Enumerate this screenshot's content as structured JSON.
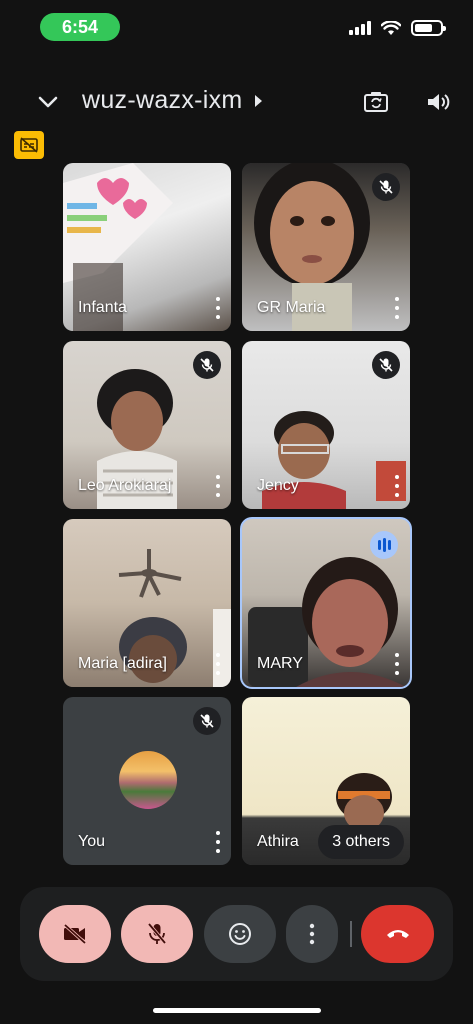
{
  "status_bar": {
    "time": "6:54"
  },
  "header": {
    "meeting_code": "wuz-wazx-ixm"
  },
  "participants": [
    {
      "name": "Infanta",
      "muted": false
    },
    {
      "name": "GR Maria",
      "muted": true
    },
    {
      "name": "Leo Arokiaraj",
      "muted": true
    },
    {
      "name": "Jency",
      "muted": true
    },
    {
      "name": "Maria [adira]",
      "muted": false
    },
    {
      "name": "MARY",
      "muted": false,
      "speaking": true
    },
    {
      "name": "You",
      "muted": true
    },
    {
      "name": "Athira",
      "muted": false,
      "others_label": "3 others"
    }
  ],
  "colors": {
    "end_call": "#dc362e",
    "muted_control": "#f2b8b5",
    "active_speaker": "#a8c7fa",
    "caption_badge": "#fbbc04"
  },
  "icons": [
    "chevron-down-icon",
    "switch-camera-icon",
    "speaker-icon",
    "captions-off-icon",
    "mic-off-icon",
    "video-off-icon",
    "emoji-icon",
    "more-vert-icon",
    "call-end-icon"
  ]
}
